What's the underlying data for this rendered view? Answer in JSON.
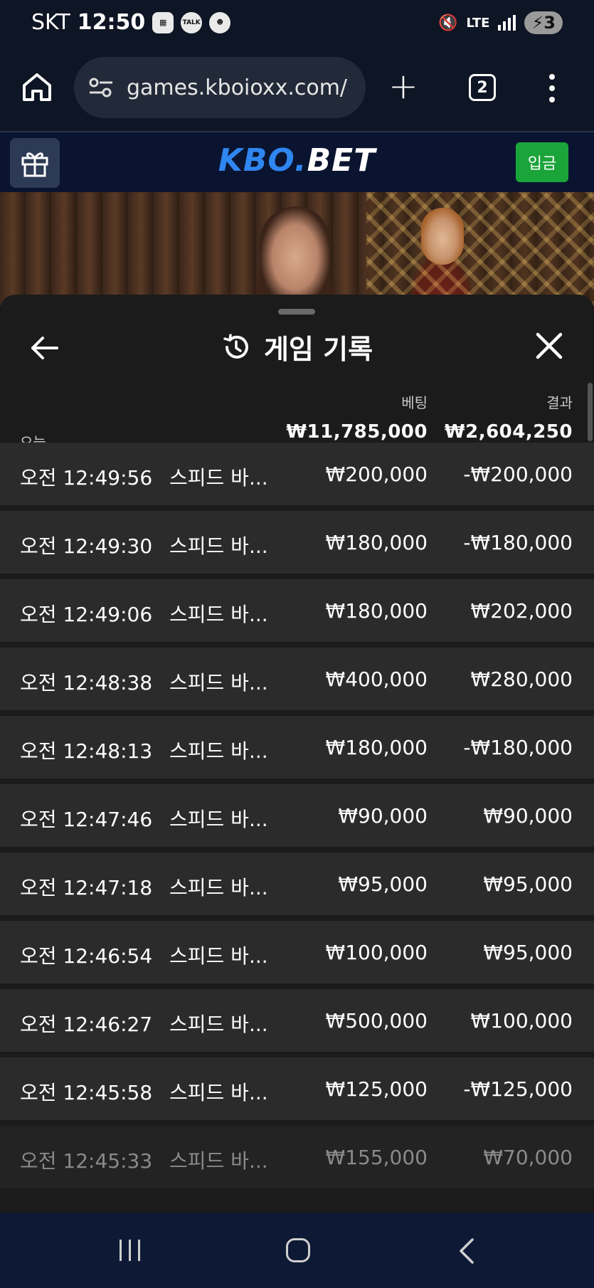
{
  "status_bar": {
    "carrier": "SKT",
    "time": "12:50",
    "network": "LTE",
    "battery": "3"
  },
  "browser": {
    "url": "games.kboioxx.com/",
    "tab_count": "2"
  },
  "site": {
    "logo_part1": "KBO.",
    "logo_part2": "BET",
    "deposit_label": "입금"
  },
  "history": {
    "title": "게임 기록",
    "bet_header": "베팅",
    "result_header": "결과",
    "today_label": "오늘",
    "total_bet": "₩11,785,000",
    "total_result": "₩2,604,250",
    "rows": [
      {
        "time": "오전 12:49:56",
        "game": "스피드 바...",
        "bet": "₩200,000",
        "result": "-₩200,000"
      },
      {
        "time": "오전 12:49:30",
        "game": "스피드 바...",
        "bet": "₩180,000",
        "result": "-₩180,000"
      },
      {
        "time": "오전 12:49:06",
        "game": "스피드 바...",
        "bet": "₩180,000",
        "result": "₩202,000"
      },
      {
        "time": "오전 12:48:38",
        "game": "스피드 바...",
        "bet": "₩400,000",
        "result": "₩280,000"
      },
      {
        "time": "오전 12:48:13",
        "game": "스피드 바...",
        "bet": "₩180,000",
        "result": "-₩180,000"
      },
      {
        "time": "오전 12:47:46",
        "game": "스피드 바...",
        "bet": "₩90,000",
        "result": "₩90,000"
      },
      {
        "time": "오전 12:47:18",
        "game": "스피드 바...",
        "bet": "₩95,000",
        "result": "₩95,000"
      },
      {
        "time": "오전 12:46:54",
        "game": "스피드 바...",
        "bet": "₩100,000",
        "result": "₩95,000"
      },
      {
        "time": "오전 12:46:27",
        "game": "스피드 바...",
        "bet": "₩500,000",
        "result": "₩100,000"
      },
      {
        "time": "오전 12:45:58",
        "game": "스피드 바...",
        "bet": "₩125,000",
        "result": "-₩125,000"
      },
      {
        "time": "오전 12:45:33",
        "game": "스피드 바...",
        "bet": "₩155,000",
        "result": "₩70,000"
      }
    ]
  },
  "icons": {
    "home": "home-icon",
    "site_info": "tune-icon",
    "new_tab": "plus-icon",
    "tabs": "tabs-icon",
    "menu": "more-vert-icon",
    "gift": "gift-icon",
    "back": "arrow-left-icon",
    "history": "history-icon",
    "close": "close-icon"
  },
  "colors": {
    "deposit_green": "#1ba43a",
    "logo_blue": "#2f86f0",
    "panel_bg": "#1b1b1b",
    "row_bg": "#2b2b2b"
  }
}
